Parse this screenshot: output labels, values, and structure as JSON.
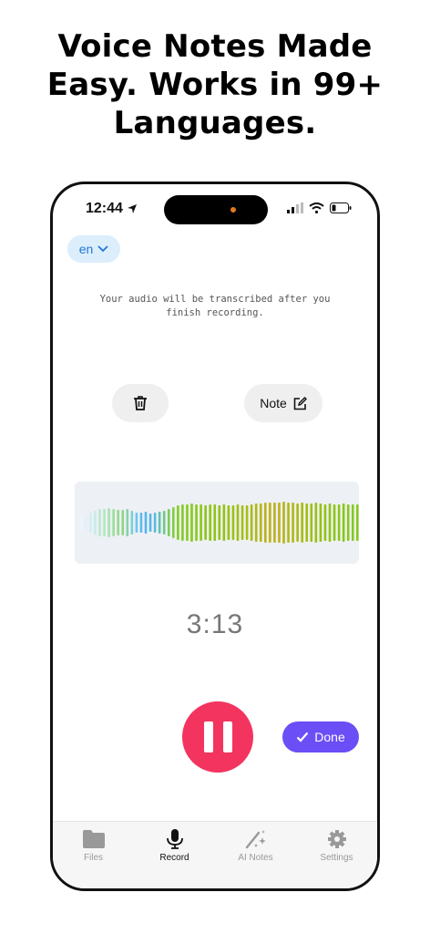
{
  "headline": {
    "line1": "Voice Notes Made",
    "line2": "Easy. Works in 99+",
    "line3": "Languages."
  },
  "status_bar": {
    "time": "12:44"
  },
  "language_selector": {
    "label": "en"
  },
  "notice": {
    "line1": "Your audio will be transcribed after you",
    "line2": "finish recording."
  },
  "actions": {
    "note_label": "Note"
  },
  "recorder": {
    "elapsed": "3:13"
  },
  "done_button": {
    "label": "Done"
  },
  "tabs": [
    {
      "label": "Files",
      "icon": "folder-icon",
      "active": false
    },
    {
      "label": "Record",
      "icon": "microphone-icon",
      "active": true
    },
    {
      "label": "AI Notes",
      "icon": "magic-wand-icon",
      "active": false
    },
    {
      "label": "Settings",
      "icon": "gear-icon",
      "active": false
    }
  ],
  "colors": {
    "accent_record": "#f3345f",
    "accent_done": "#6b4ef5",
    "language_pill": "#dceefc"
  }
}
